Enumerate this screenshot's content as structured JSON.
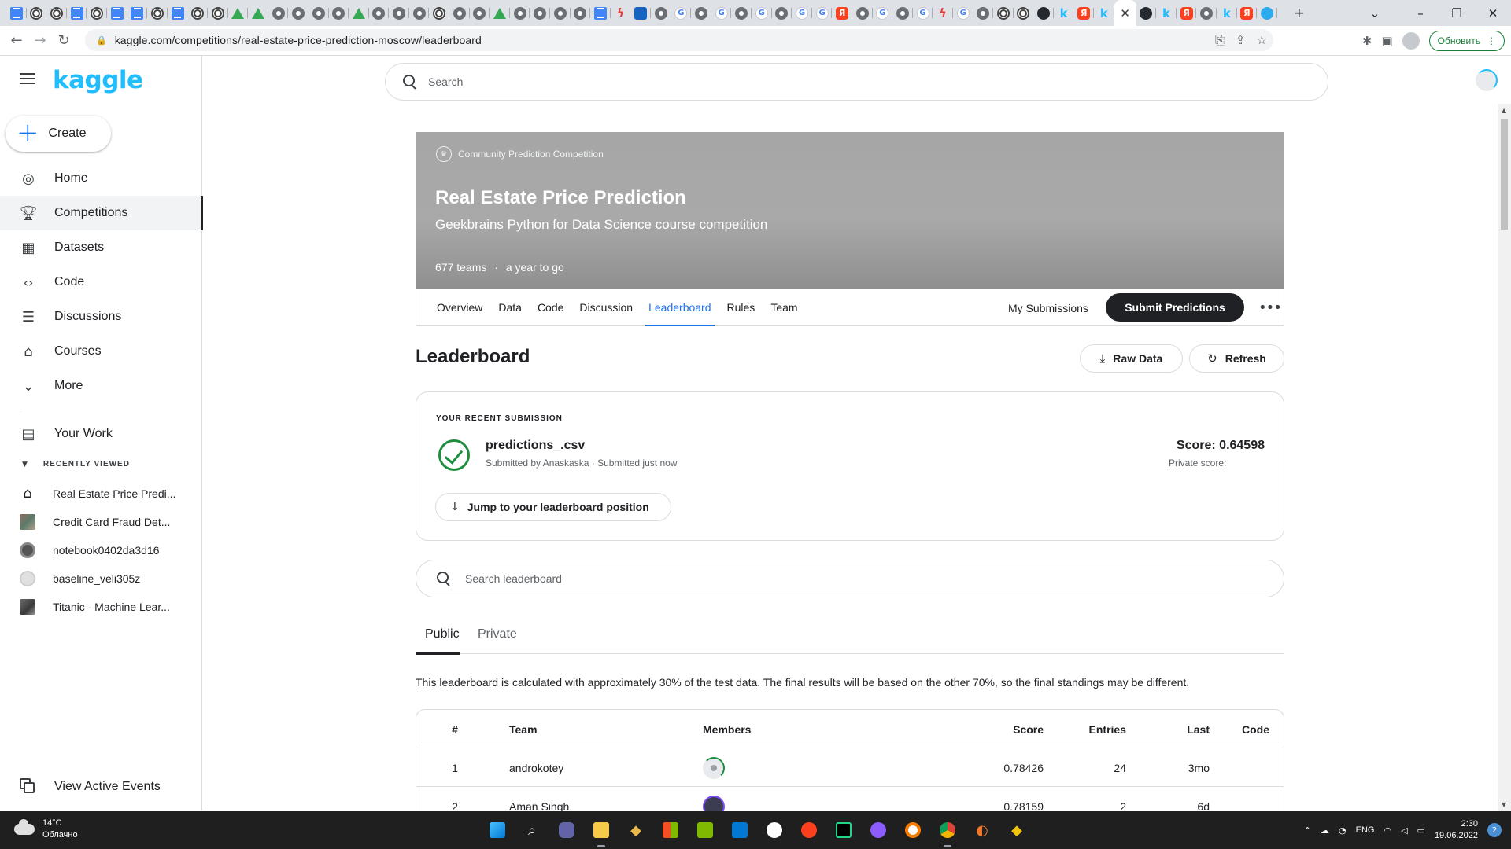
{
  "browser": {
    "url": "kaggle.com/competitions/real-estate-price-prediction-moscow/leaderboard",
    "update_button": "Обновить",
    "tabs": [
      {
        "icon": "docs"
      },
      {
        "icon": "openai"
      },
      {
        "icon": "openai"
      },
      {
        "icon": "docs"
      },
      {
        "icon": "openai"
      },
      {
        "icon": "docs"
      },
      {
        "icon": "docs"
      },
      {
        "icon": "openai"
      },
      {
        "icon": "docs"
      },
      {
        "icon": "openai"
      },
      {
        "icon": "openai"
      },
      {
        "icon": "drive"
      },
      {
        "icon": "drive"
      },
      {
        "icon": "grey"
      },
      {
        "icon": "grey"
      },
      {
        "icon": "grey"
      },
      {
        "icon": "grey"
      },
      {
        "icon": "drive"
      },
      {
        "icon": "grey"
      },
      {
        "icon": "grey"
      },
      {
        "icon": "grey"
      },
      {
        "icon": "openai"
      },
      {
        "icon": "grey"
      },
      {
        "icon": "grey"
      },
      {
        "icon": "drive"
      },
      {
        "icon": "grey"
      },
      {
        "icon": "grey"
      },
      {
        "icon": "grey"
      },
      {
        "icon": "grey"
      },
      {
        "icon": "docs"
      },
      {
        "icon": "flash"
      },
      {
        "icon": "blue"
      },
      {
        "icon": "grey"
      },
      {
        "icon": "gt"
      },
      {
        "icon": "grey"
      },
      {
        "icon": "gt"
      },
      {
        "icon": "grey"
      },
      {
        "icon": "gt"
      },
      {
        "icon": "grey"
      },
      {
        "icon": "gt"
      },
      {
        "icon": "gt"
      },
      {
        "icon": "yandex"
      },
      {
        "icon": "grey"
      },
      {
        "icon": "gt"
      },
      {
        "icon": "grey"
      },
      {
        "icon": "gt"
      },
      {
        "icon": "flash"
      },
      {
        "icon": "gt"
      },
      {
        "icon": "grey"
      },
      {
        "icon": "openai"
      },
      {
        "icon": "openai"
      },
      {
        "icon": "github"
      },
      {
        "icon": "kaggle"
      },
      {
        "icon": "yandex"
      },
      {
        "icon": "kaggle"
      }
    ],
    "tabs_after": [
      {
        "icon": "github"
      },
      {
        "icon": "kaggle"
      },
      {
        "icon": "yandex"
      },
      {
        "icon": "grey"
      },
      {
        "icon": "kaggle"
      },
      {
        "icon": "yandex"
      },
      {
        "icon": "telegram"
      }
    ]
  },
  "sidebar": {
    "logo": "kaggle",
    "create_label": "Create",
    "items": [
      {
        "label": "Home",
        "icon": "compass-icon"
      },
      {
        "label": "Competitions",
        "icon": "trophy-icon"
      },
      {
        "label": "Datasets",
        "icon": "table-icon"
      },
      {
        "label": "Code",
        "icon": "code-icon"
      },
      {
        "label": "Discussions",
        "icon": "discussion-icon"
      },
      {
        "label": "Courses",
        "icon": "school-icon"
      },
      {
        "label": "More",
        "icon": "chevron-down-icon"
      }
    ],
    "your_work": "Your Work",
    "recently_viewed_label": "RECENTLY VIEWED",
    "recently_viewed": [
      {
        "label": "Real Estate Price Predi...",
        "thumb": "house"
      },
      {
        "label": "Credit Card Fraud Det...",
        "thumb": "image"
      },
      {
        "label": "notebook0402da3d16",
        "thumb": "avatar-dark"
      },
      {
        "label": "baseline_veli305z",
        "thumb": "avatar-light"
      },
      {
        "label": "Titanic - Machine Lear...",
        "thumb": "image-dark"
      }
    ],
    "view_active_events": "View Active Events"
  },
  "search": {
    "placeholder": "Search"
  },
  "competition": {
    "type": "Community Prediction Competition",
    "title": "Real Estate Price Prediction",
    "subtitle": "Geekbrains Python for Data Science course competition",
    "teams": "677 teams",
    "separator": "·",
    "deadline": "a year to go",
    "tabs": [
      "Overview",
      "Data",
      "Code",
      "Discussion",
      "Leaderboard",
      "Rules",
      "Team"
    ],
    "active_tab": "Leaderboard",
    "my_submissions": "My Submissions",
    "submit_predictions": "Submit Predictions"
  },
  "leaderboard": {
    "title": "Leaderboard",
    "raw_data": "Raw Data",
    "refresh": "Refresh",
    "recent": {
      "label": "YOUR RECENT SUBMISSION",
      "filename": "predictions_.csv",
      "submitted_by": "Submitted by Anaskaska · Submitted just now",
      "score": "Score: 0.64598",
      "private_score": "Private score:",
      "jump": "Jump to your leaderboard position"
    },
    "search_placeholder": "Search leaderboard",
    "tabs": [
      "Public",
      "Private"
    ],
    "note": "This leaderboard is calculated with approximately 30% of the test data. The final results will be based on the other 70%, so the final standings may be different.",
    "columns": [
      "#",
      "Team",
      "Members",
      "Score",
      "Entries",
      "Last",
      "Code"
    ],
    "rows": [
      {
        "rank": "1",
        "team": "androkotey",
        "score": "0.78426",
        "entries": "24",
        "last": "3mo"
      },
      {
        "rank": "2",
        "team": "Aman Singh",
        "score": "0.78159",
        "entries": "2",
        "last": "6d"
      }
    ]
  },
  "taskbar": {
    "temperature": "14°C",
    "condition": "Облачно",
    "lang": "ENG",
    "time": "2:30",
    "date": "19.06.2022",
    "notifications": "2"
  }
}
